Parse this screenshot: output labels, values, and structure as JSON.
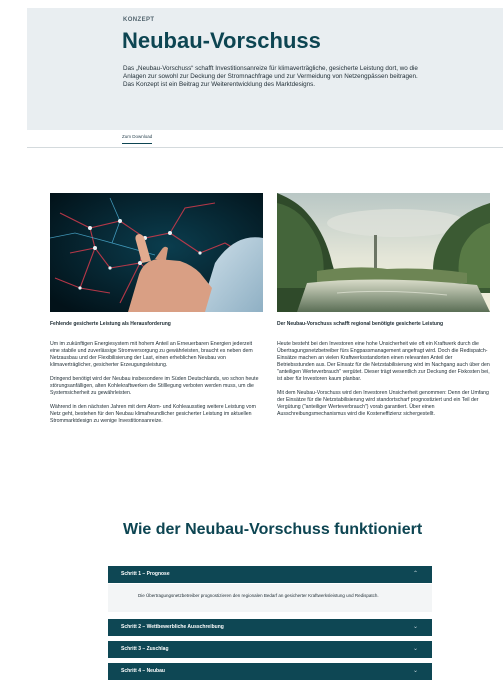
{
  "hero": {
    "kicker": "KONZEPT",
    "title": "Neubau-Vorschuss",
    "description": "Das „Neubau-Vorschuss“ schafft Investitionsanreize für klimaverträgliche, gesicherte Leistung dort, wo die Anlagen zur sowohl zur Deckung der Stromnachfrage und zur Vermeidung von Netzengpässen beitragen. Das Konzept ist ein Beitrag zur Weiterentwicklung des Marktdesigns."
  },
  "tabs": [
    {
      "label": "Zum Download",
      "active": true
    }
  ],
  "left_column": {
    "image_icon": "map-touchscreen-photo",
    "heading": "Fehlende gesicherte Leistung als Herausforderung",
    "paragraphs": [
      "Um im zukünftigen Energiesystem mit hohem Anteil an Erneuerbaren Energien jederzeit eine stabile und zuverlässige Stromversorgung zu gewährleisten, braucht es neben dem Netzausbau und der Flexibilisierung der Last, einen erheblichen Neubau von klimaverträglicher, gesicherter Erzeugungsleistung.",
      "Dringend benötigt wird der Neubau insbesondere im Süden Deutschlands, wo schon heute störungsanfälligen, alten Kohlekraftwerken die Stilllegung verboten werden muss, um die Systemsicherheit zu gewährleisten.",
      "Während in den nächsten Jahren mit dem Atom- und Kohleausstieg weitere Leistung vom Netz geht, bestehen für den Neubau klimafreundlicher gesicherter Leistung im aktuellen Strommarktdesign zu wenige Investitionsanreize."
    ]
  },
  "right_column": {
    "image_icon": "river-landscape-photo",
    "heading": "Der Neubau-Vorschuss schafft regional benötigte gesicherte Leistung",
    "paragraphs": [
      "Heute besteht bei den Investoren eine hohe Unsicherheit wie oft ein Kraftwerk durch die Übertragungsnetzbetreiber fürs Engpassmanagement angefragt wird. Doch die Redispatch-Einsätze machen an vielen Kraftwerksstandorten einen relevanten Anteil der Betriebsstunden aus. Der Einsatz für die Netzstabilisierung wird im Nachgang auch über den \"anteiligen Werteverbrauch\" vergütet. Dieser trägt wesentlich zur Deckung der Fixkosten bei, ist aber für Investoren kaum planbar.",
      "Mit dem Neubau-Vorschuss wird den Investoren Unsicherheit genommen: Denn der Umfang der Einsätze für die Netzstabilisierung wird standortscharf prognostiziert und ein Teil der Vergütung (\"anteiliger Werteverbrauch\") vorab garantiert. Über einen Ausschreibungsmechanismus wird die Kosteneffizienz sichergestellt."
    ]
  },
  "section": {
    "title": "Wie der Neubau-Vorschuss funktioniert"
  },
  "accordion": [
    {
      "label": "Schritt 1 – Prognose",
      "expanded": true,
      "body": "Die Übertragungsnetzbetreiber prognostizieren den regionalen Bedarf an gesicherter Kraftwerksleistung und Redispatch."
    },
    {
      "label": "Schritt 2 – Wettbewerbliche Ausschreibung",
      "expanded": false
    },
    {
      "label": "Schritt 3 – Zuschlag",
      "expanded": false
    },
    {
      "label": "Schritt 4 – Neubau",
      "expanded": false
    }
  ],
  "icons": {
    "expanded": "chevron-up-icon",
    "collapsed": "chevron-down-icon"
  },
  "colors": {
    "brand": "#0d4552",
    "accordion_bg": "#0e4754",
    "hero_bg": "#e9eef1"
  }
}
